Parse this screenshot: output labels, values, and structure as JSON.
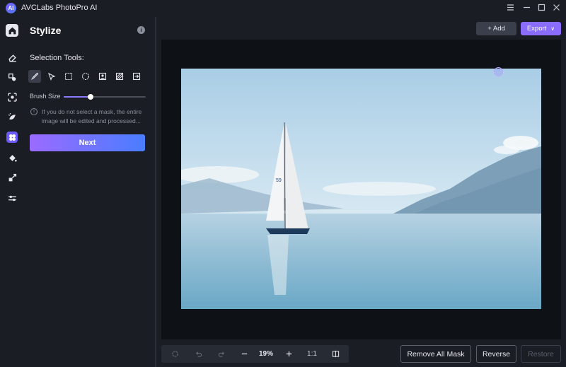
{
  "app": {
    "title": "AVCLabs PhotoPro AI",
    "logo_text": "AI"
  },
  "window": {
    "menu_icon": "hamburger-icon",
    "minimize_icon": "minimize-icon",
    "maximize_icon": "maximize-icon",
    "close_icon": "close-icon"
  },
  "iconbar": {
    "items": [
      {
        "name": "home",
        "icon": "home-icon"
      },
      {
        "name": "eraser",
        "icon": "eraser-icon"
      },
      {
        "name": "replace",
        "icon": "replace-icon"
      },
      {
        "name": "background",
        "icon": "background-icon"
      },
      {
        "name": "enhance",
        "icon": "enhance-icon"
      },
      {
        "name": "stylize",
        "icon": "stylize-icon",
        "active": true
      },
      {
        "name": "colorize",
        "icon": "bucket-icon"
      },
      {
        "name": "resize",
        "icon": "resize-icon"
      },
      {
        "name": "adjust",
        "icon": "sliders-icon"
      }
    ]
  },
  "panel": {
    "title": "Stylize",
    "info_symbol": "i",
    "selection_label": "Selection Tools:",
    "tools": [
      {
        "name": "brush-tool",
        "icon": "brush-icon",
        "active": true
      },
      {
        "name": "polygon-tool",
        "icon": "lasso-icon"
      },
      {
        "name": "rectangle-tool",
        "icon": "rectangle-select-icon"
      },
      {
        "name": "ellipse-tool",
        "icon": "ellipse-select-icon"
      },
      {
        "name": "portrait-tool",
        "icon": "person-select-icon"
      },
      {
        "name": "invert-tool",
        "icon": "invert-select-icon"
      },
      {
        "name": "import-tool",
        "icon": "import-mask-icon"
      }
    ],
    "brush_label": "Brush Size",
    "brush_level": 0.33,
    "hint_symbol": "i",
    "hint": "If you do not select a mask, the entire image will be edited and processed...",
    "next_label": "Next"
  },
  "topbar": {
    "add_label": "+ Add",
    "export_label": "Export",
    "export_caret": "∨"
  },
  "bottombar": {
    "zoom": "19%",
    "ratio": "1:1"
  },
  "actions": {
    "remove_all_mask": "Remove All Mask",
    "reverse": "Reverse",
    "restore": "Restore"
  },
  "colors": {
    "accent": "#8a6cff",
    "bg": "#1a1d24",
    "canvas": "#0e1217"
  }
}
